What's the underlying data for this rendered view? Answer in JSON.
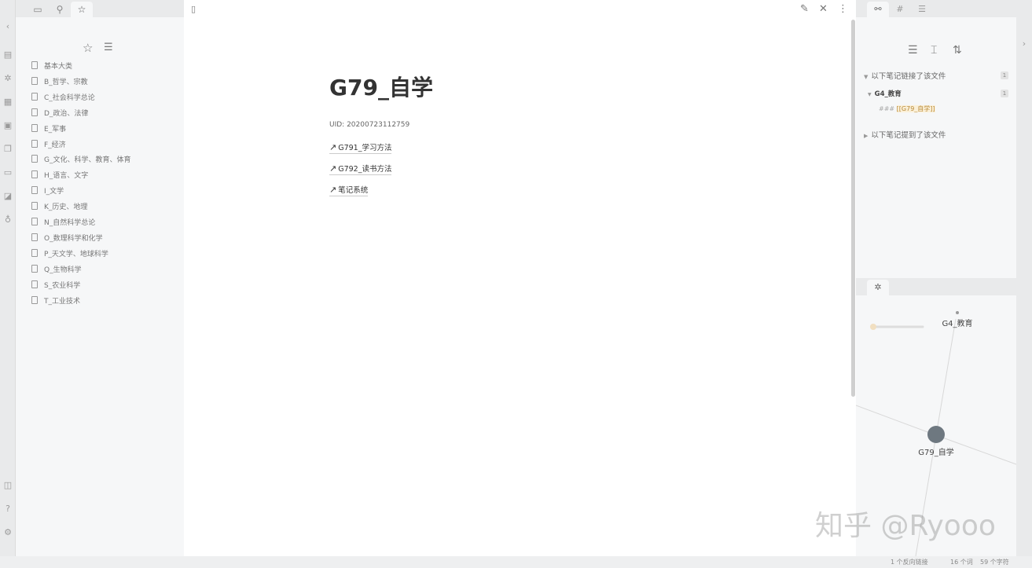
{
  "left_sidebar": {
    "starred_items": [
      "基本大类",
      "B_哲学、宗教",
      "C_社会科学总论",
      "D_政治、法律",
      "E_军事",
      "F_经济",
      "G_文化、科学、教育、体育",
      "H_语言、文字",
      "I_文学",
      "K_历史、地理",
      "N_自然科学总论",
      "O_数理科学和化学",
      "P_天文学、地球科学",
      "Q_生物科学",
      "S_农业科学",
      "T_工业技术"
    ]
  },
  "editor": {
    "title": "G79_自学",
    "uid": "UID: 20200723112759",
    "links": [
      {
        "arrow": "↗",
        "text": "G791_学习方法"
      },
      {
        "arrow": "↗",
        "text": "G792_读书方法"
      },
      {
        "arrow": "↗",
        "text": "笔记系统"
      }
    ]
  },
  "backlinks": {
    "linked_header": "以下笔记链接了该文件",
    "linked_count": "1",
    "file_name": "G4_教育",
    "file_count": "1",
    "snippet_prefix": "###",
    "snippet_link": "[[G79_自学]]",
    "unlinked_header": "以下笔记提到了该文件"
  },
  "graph": {
    "nodes": [
      "G4_教育",
      "G79_自学"
    ]
  },
  "status_bar": {
    "backlinks": "1 个反向链接",
    "words": "16 个词",
    "chars": "59 个字符"
  },
  "watermark": "知乎 @Ryooo",
  "icons": {
    "ribbon": [
      "file-icon",
      "graph-icon",
      "plugin-icon",
      "calendar-icon",
      "copy-icon",
      "inbox-icon",
      "switch-icon",
      "mic-icon",
      "vault-icon",
      "help-icon",
      "settings-icon"
    ]
  },
  "colors": {
    "accent_node": "#6e7880",
    "link_accent": "#c9a26b"
  }
}
